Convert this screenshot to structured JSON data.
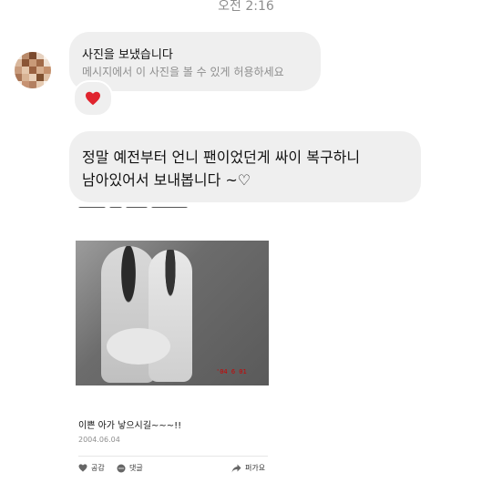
{
  "header": {
    "timestamp": "오전 2:16"
  },
  "thread": {
    "shared_photo": {
      "title": "사진을 보냈습니다",
      "subtitle": "메시지에서 이 사진을 볼 수 있게 허용하세요",
      "reaction": "heart-icon"
    },
    "message": {
      "text": "정말 예전부터 언니 팬이었던게 싸이 복구하니\n남아있어서 보내봅니다 ~♡"
    },
    "post": {
      "caption": "이쁜 아가 낳으시길~~~!!",
      "date": "2004.06.04",
      "actions": {
        "like": "공감",
        "comment": "댓글",
        "share": "퍼가요"
      }
    }
  },
  "colors": {
    "bubble": "#efefef",
    "muted": "#8e8e8e",
    "heart": "#e0242e"
  }
}
